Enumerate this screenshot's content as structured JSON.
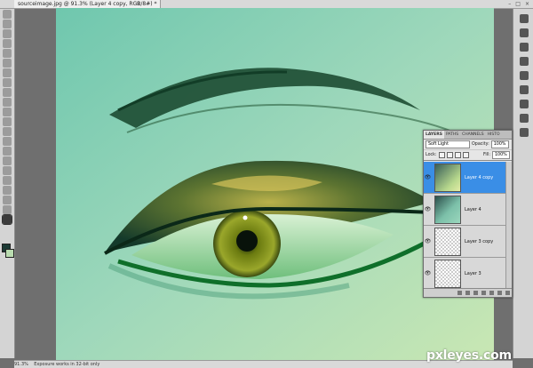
{
  "document": {
    "tab_title": "sourceimage.jpg @ 91.3% (Layer 4 copy, RGB/8#) *",
    "close_glyph": "×"
  },
  "window": {
    "minimize": "–",
    "maximize": "□",
    "close": "×"
  },
  "toolbox": {
    "tools": [
      "move-tool",
      "marquee-tool",
      "lasso-tool",
      "quick-select-tool",
      "crop-tool",
      "eyedropper-tool",
      "healing-brush-tool",
      "brush-tool",
      "clone-stamp-tool",
      "history-brush-tool",
      "eraser-tool",
      "gradient-tool",
      "blur-tool",
      "dodge-tool",
      "pen-tool",
      "type-tool",
      "path-select-tool",
      "shape-tool",
      "3d-rotate-tool",
      "3d-orbit-tool",
      "hand-tool",
      "zoom-tool"
    ],
    "colors": {
      "foreground": "#1b3a35",
      "background": "#b9dcb0"
    }
  },
  "layers_panel": {
    "tabs": [
      "LAYERS",
      "PATHS",
      "CHANNELS",
      "HISTO"
    ],
    "blend_mode": "Soft Light",
    "opacity_label": "Opacity:",
    "opacity_value": "100%",
    "lock_label": "Lock:",
    "fill_label": "Fill:",
    "fill_value": "100%",
    "layers": [
      {
        "name": "Layer 4 copy",
        "selected": true
      },
      {
        "name": "Layer 4",
        "selected": false
      },
      {
        "name": "Layer 3 copy",
        "selected": false
      },
      {
        "name": "Layer 3",
        "selected": false
      }
    ]
  },
  "status": {
    "zoom": "91.3%",
    "doc_info": "Exposure works in 32-bit only"
  },
  "watermark": "pxleyes.com"
}
